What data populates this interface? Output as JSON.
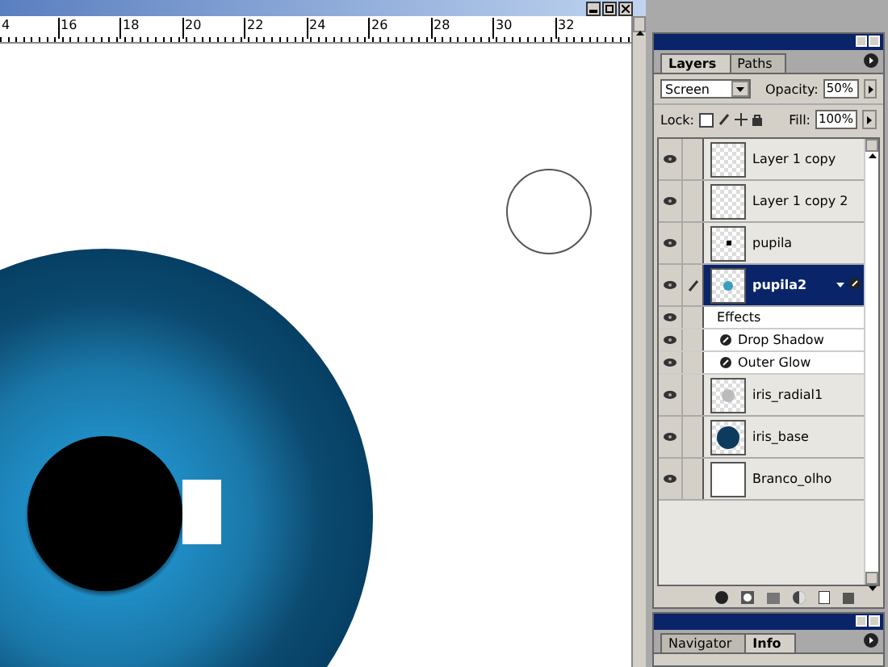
{
  "document": {
    "ruler_labels": [
      "4",
      "16",
      "18",
      "20",
      "22",
      "24",
      "26",
      "28",
      "30",
      "32"
    ]
  },
  "layers_panel": {
    "tabs": [
      {
        "label": "Layers",
        "selected": true
      },
      {
        "label": "Paths",
        "selected": false
      }
    ],
    "blend_mode": "Screen",
    "opacity_label": "Opacity:",
    "opacity": "50%",
    "lock_label": "Lock:",
    "lock_transparency": {
      "checked": false
    },
    "fill_label": "Fill:",
    "fill": "100%",
    "layers": [
      {
        "name": "Layer 1 copy",
        "visible": true,
        "selected": false,
        "kind": "empty"
      },
      {
        "name": "Layer 1 copy 2",
        "visible": true,
        "selected": false,
        "kind": "empty"
      },
      {
        "name": "pupila",
        "visible": true,
        "selected": false,
        "kind": "dot"
      },
      {
        "name": "pupila2",
        "visible": true,
        "selected": true,
        "kind": "glow",
        "effects": {
          "label": "Effects",
          "visible": true,
          "items": [
            {
              "name": "Drop Shadow",
              "visible": true
            },
            {
              "name": "Outer Glow",
              "visible": true
            }
          ]
        }
      },
      {
        "name": "iris_radial1",
        "visible": true,
        "selected": false,
        "kind": "blur"
      },
      {
        "name": "iris_base",
        "visible": true,
        "selected": false,
        "kind": "disc"
      },
      {
        "name": "Branco_olho",
        "visible": true,
        "selected": false,
        "kind": "white"
      }
    ]
  },
  "navigator_panel": {
    "tabs": [
      {
        "label": "Navigator",
        "selected": false
      },
      {
        "label": "Info",
        "selected": true
      }
    ]
  }
}
